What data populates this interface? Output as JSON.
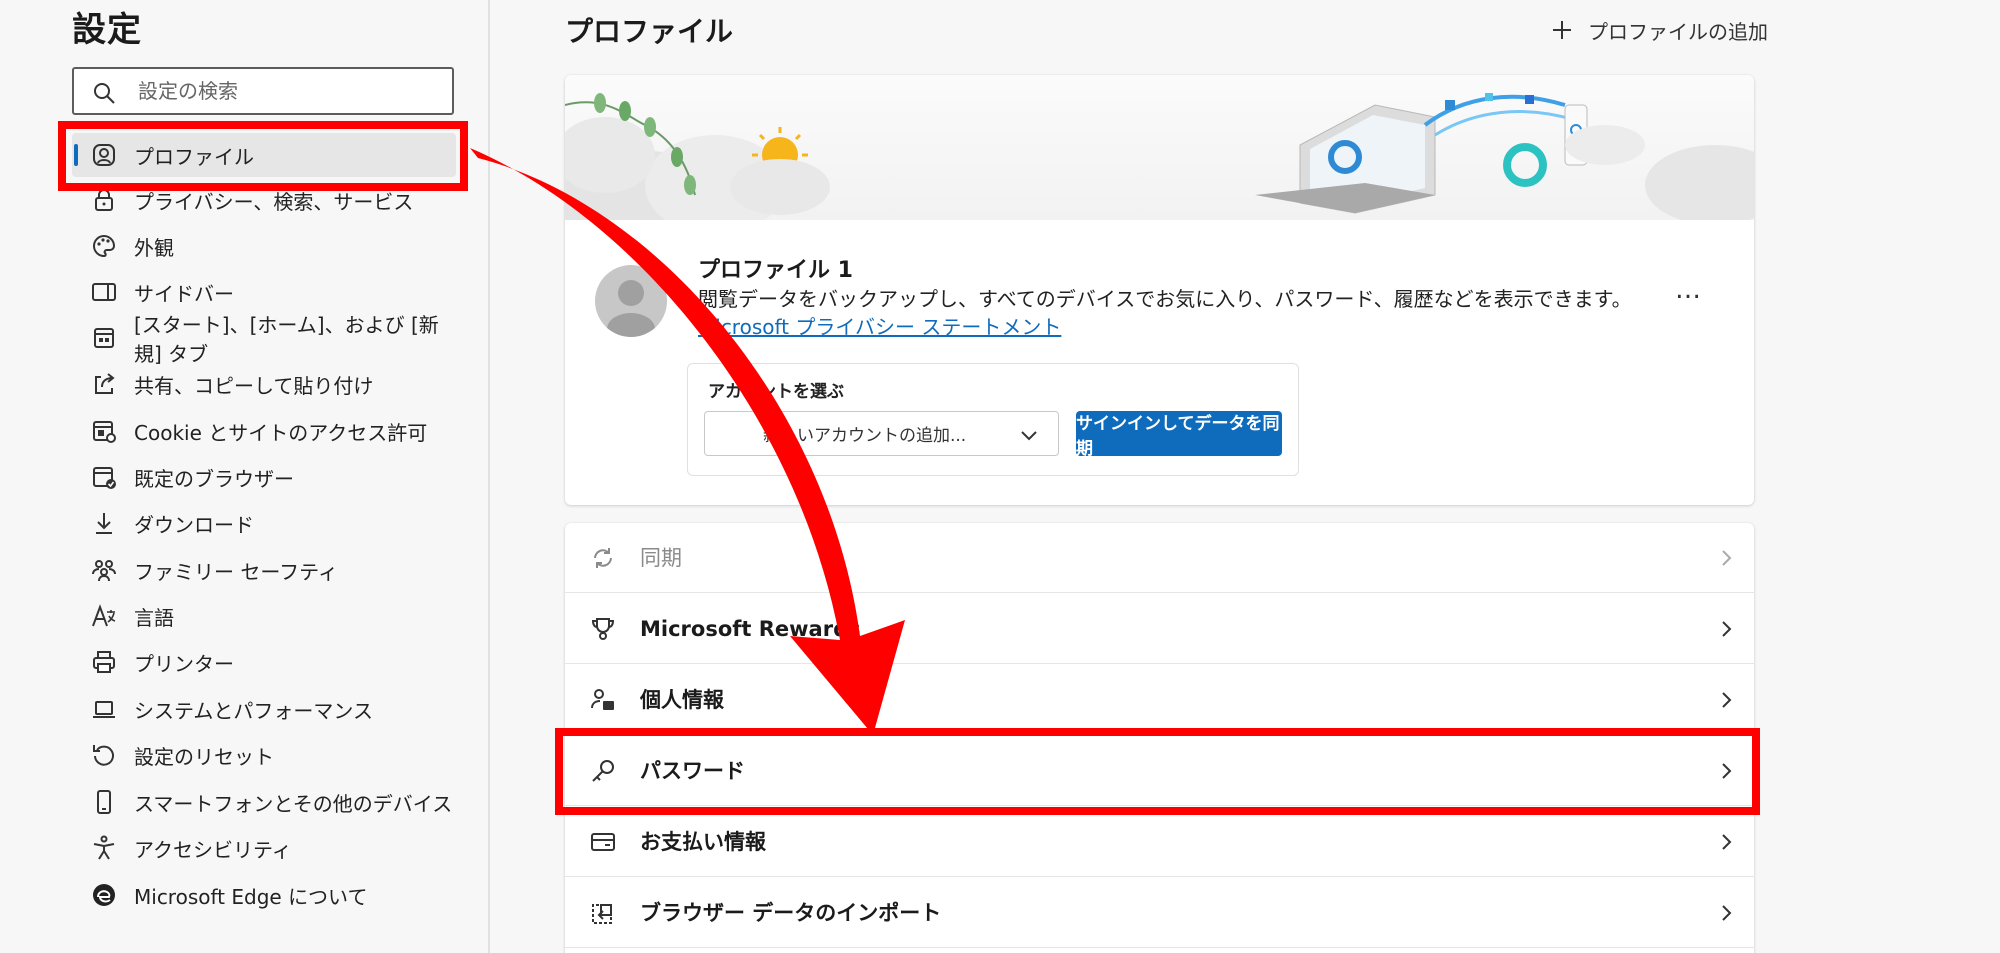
{
  "sidebar": {
    "title": "設定",
    "search_placeholder": "設定の検索",
    "items": [
      {
        "label": "プロファイル",
        "icon": "profile-icon"
      },
      {
        "label": "プライバシー、検索、サービス",
        "icon": "lock-icon"
      },
      {
        "label": "外観",
        "icon": "palette-icon"
      },
      {
        "label": "サイドバー",
        "icon": "sidebar-icon"
      },
      {
        "label": "[スタート]、[ホーム]、および [新規] タブ",
        "icon": "newtab-icon"
      },
      {
        "label": "共有、コピーして貼り付け",
        "icon": "share-icon"
      },
      {
        "label": "Cookie とサイトのアクセス許可",
        "icon": "cookie-icon"
      },
      {
        "label": "既定のブラウザー",
        "icon": "browser-icon"
      },
      {
        "label": "ダウンロード",
        "icon": "download-icon"
      },
      {
        "label": "ファミリー セーフティ",
        "icon": "family-icon"
      },
      {
        "label": "言語",
        "icon": "language-icon"
      },
      {
        "label": "プリンター",
        "icon": "printer-icon"
      },
      {
        "label": "システムとパフォーマンス",
        "icon": "laptop-icon"
      },
      {
        "label": "設定のリセット",
        "icon": "reset-icon"
      },
      {
        "label": "スマートフォンとその他のデバイス",
        "icon": "phone-icon"
      },
      {
        "label": "アクセシビリティ",
        "icon": "accessibility-icon"
      },
      {
        "label": "Microsoft Edge について",
        "icon": "edge-logo-icon"
      }
    ]
  },
  "main": {
    "title": "プロファイル",
    "add_profile_label": "プロファイルの追加",
    "profile": {
      "name": "プロファイル 1",
      "description": "閲覧データをバックアップし、すべてのデバイスでお気に入り、パスワード、履歴などを表示できます。",
      "privacy_link": "Microsoft プライバシー ステートメント",
      "more": "…",
      "account_label": "アカウントを選ぶ",
      "account_value": "新しいアカウントの追加...",
      "sync_button": "サインインしてデータを同期"
    },
    "list": [
      {
        "label": "同期",
        "icon": "sync-icon",
        "disabled": true
      },
      {
        "label": "Microsoft Rewards",
        "icon": "trophy-icon"
      },
      {
        "label": "個人情報",
        "icon": "personal-info-icon"
      },
      {
        "label": "パスワード",
        "icon": "key-icon"
      },
      {
        "label": "お支払い情報",
        "icon": "card-icon"
      },
      {
        "label": "ブラウザー データのインポート",
        "icon": "import-icon"
      }
    ]
  },
  "colors": {
    "accent": "#0f6cbd",
    "annotation": "#ff0000"
  }
}
